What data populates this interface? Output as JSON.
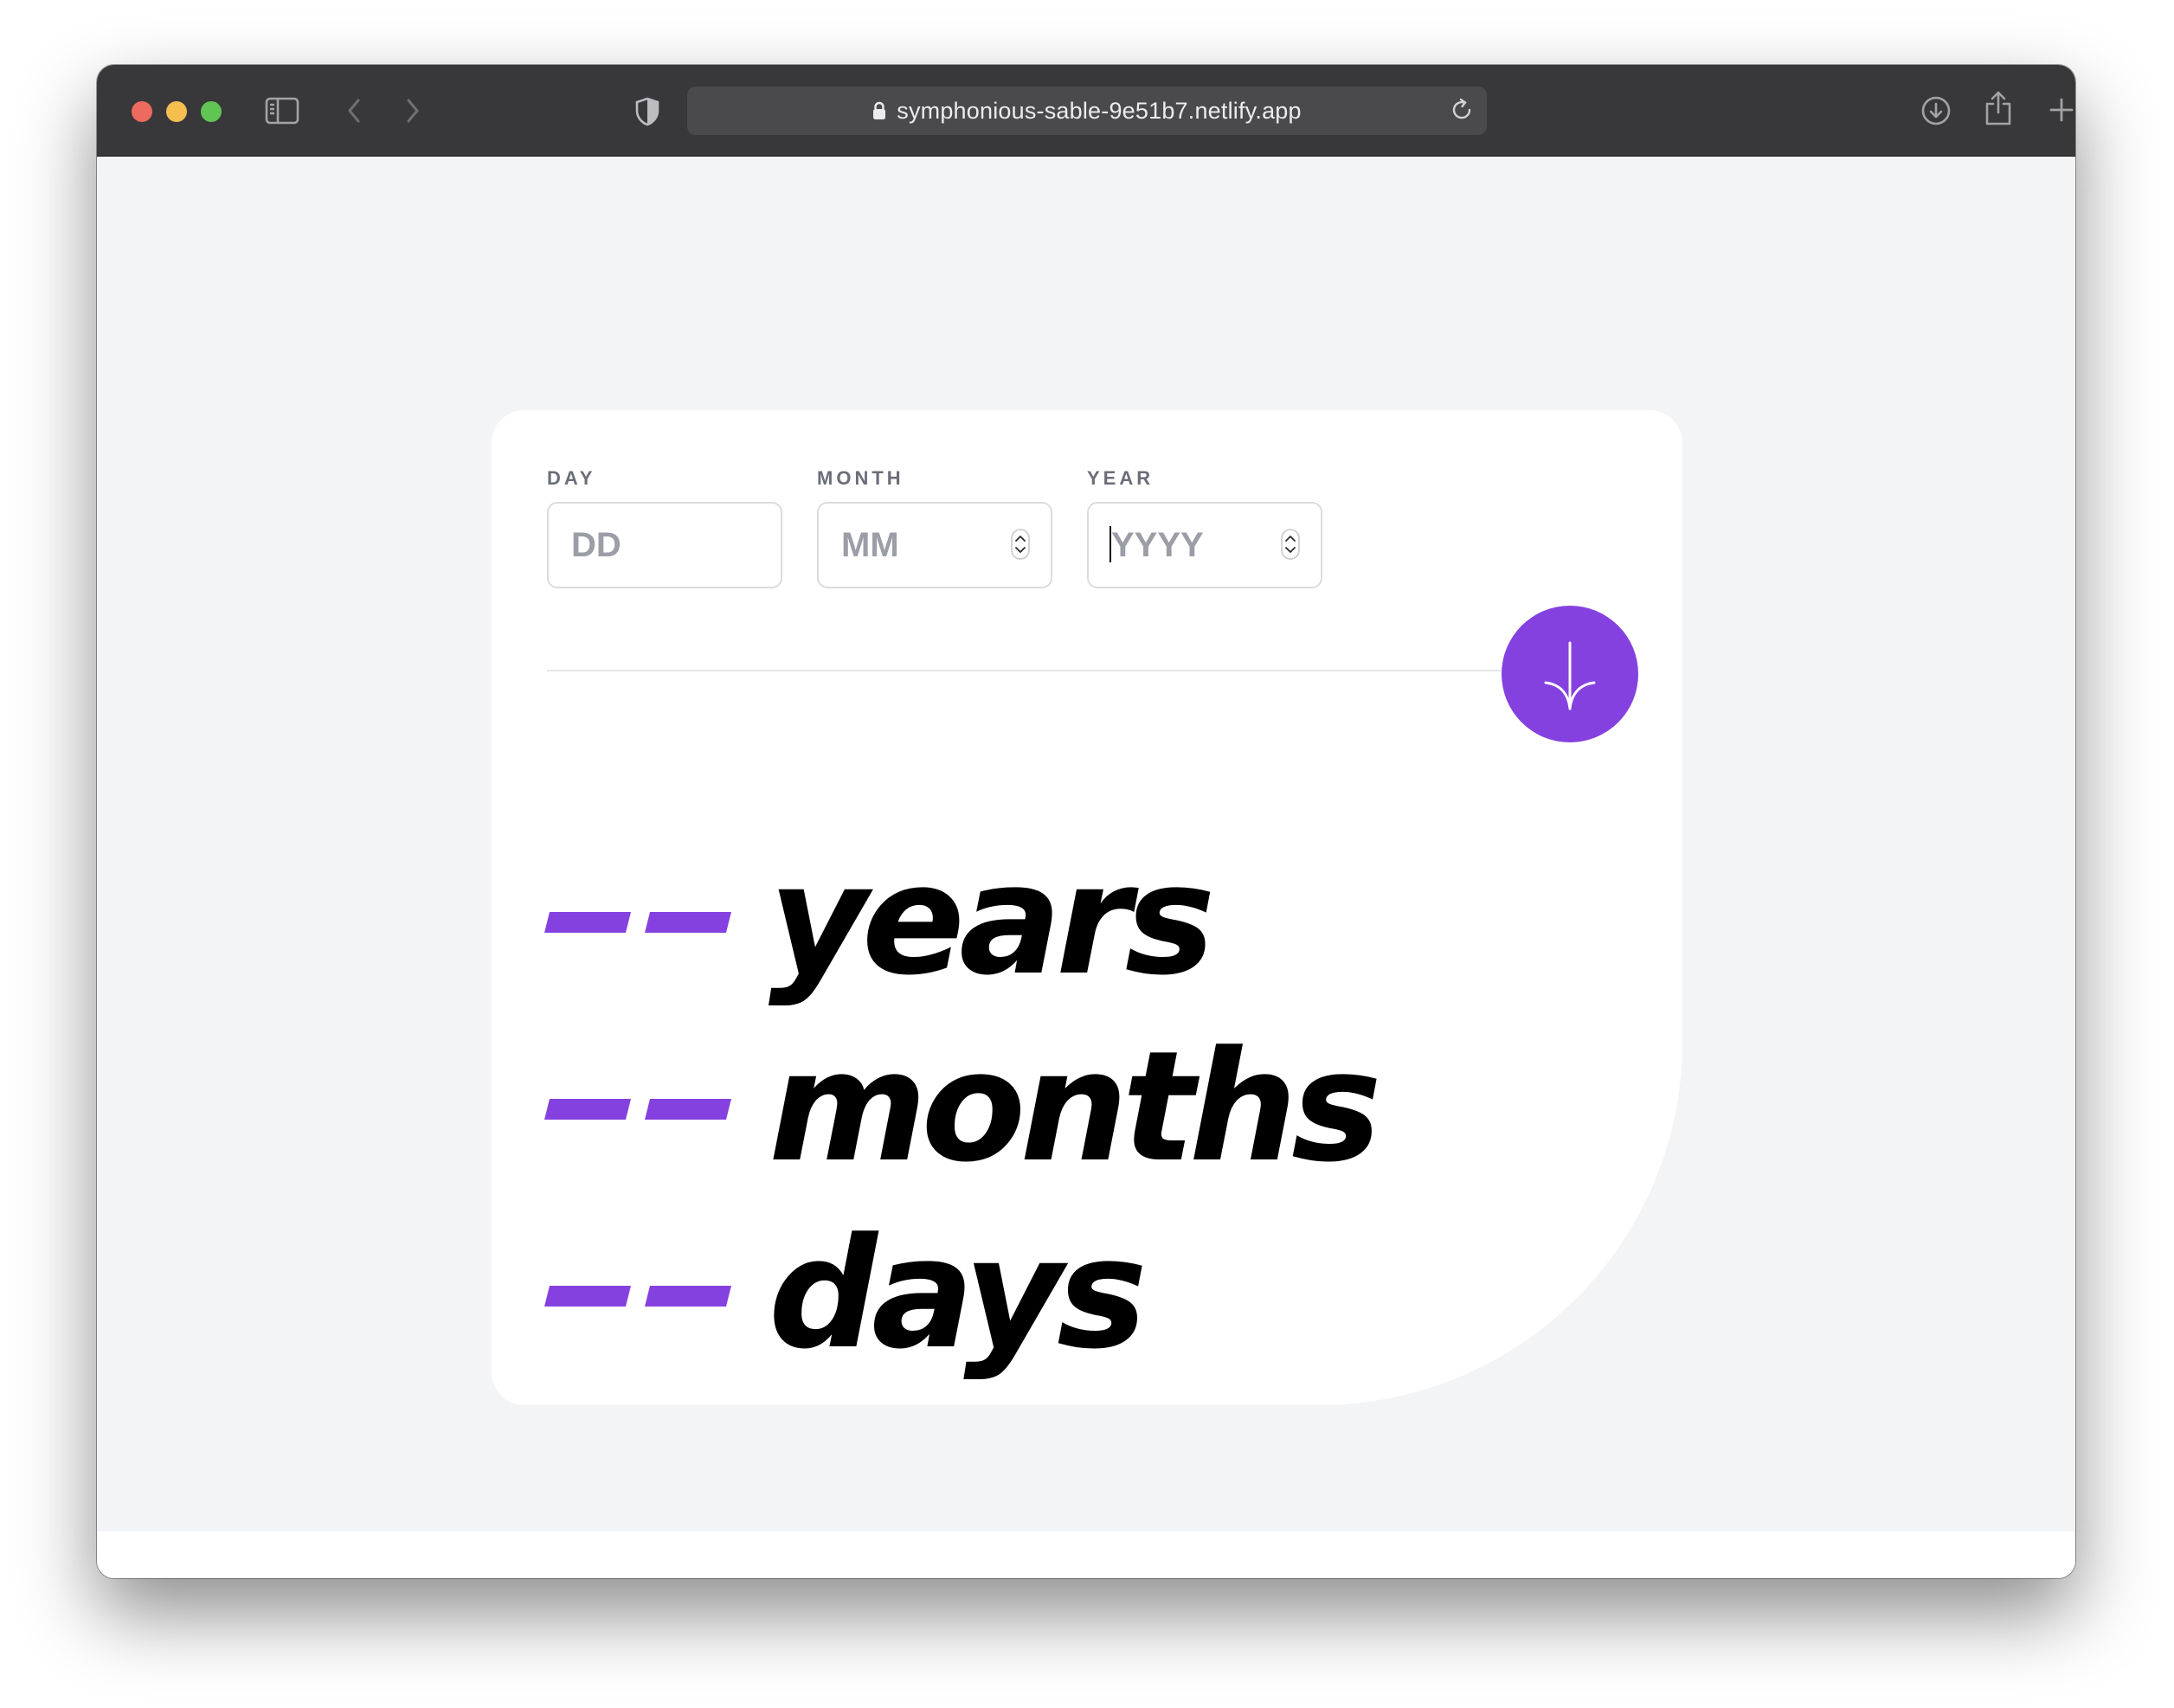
{
  "browser": {
    "url": "symphonious-sable-9e51b7.netlify.app",
    "icons": {
      "close": "close-window-icon",
      "minimize": "minimize-window-icon",
      "zoom": "zoom-window-icon",
      "sidebar": "sidebar-icon",
      "back": "chevron-left-icon",
      "forward": "chevron-right-icon",
      "shield": "privacy-shield-icon",
      "lock": "lock-icon",
      "reload": "reload-icon",
      "downloads": "download-icon",
      "share": "share-icon",
      "new_tab": "plus-icon",
      "tabs": "tab-overview-icon"
    },
    "colors": {
      "close": "#ed6a5e",
      "minimize": "#f5bf4f",
      "zoom": "#61c554"
    }
  },
  "form": {
    "day": {
      "label": "DAY",
      "placeholder": "DD",
      "value": ""
    },
    "month": {
      "label": "MONTH",
      "placeholder": "MM",
      "value": ""
    },
    "year": {
      "label": "YEAR",
      "placeholder": "YYYY",
      "value": ""
    },
    "submit_icon": "arrow-down-icon"
  },
  "results": {
    "years": {
      "value": "--",
      "unit": "years"
    },
    "months": {
      "value": "--",
      "unit": "months"
    },
    "days": {
      "value": "--",
      "unit": "days"
    }
  },
  "colors": {
    "accent": "#8541e0",
    "page_background": "#f3f4f6",
    "card_background": "#ffffff",
    "label": "#6b6e78",
    "text": "#000000"
  }
}
